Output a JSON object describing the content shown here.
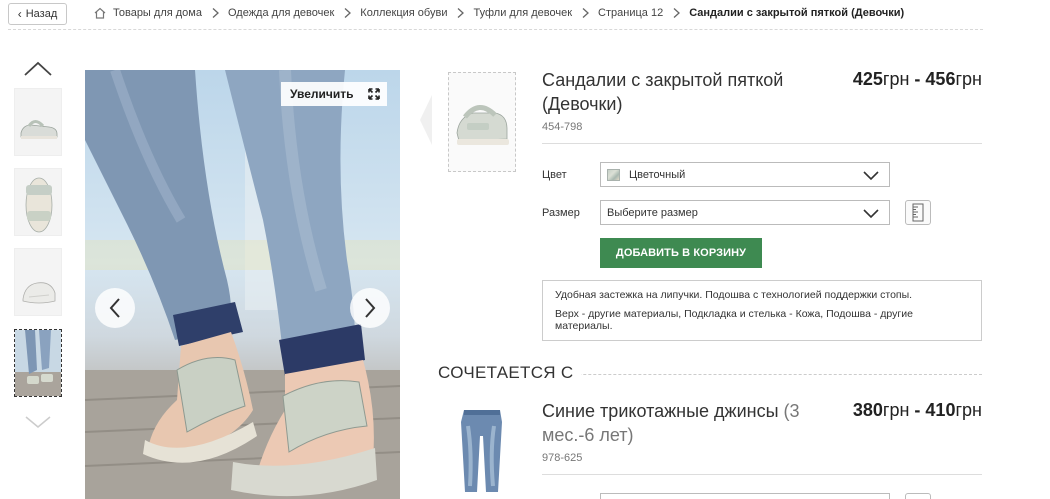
{
  "nav": {
    "back_label": "Назад",
    "breadcrumbs": [
      "Товары для дома",
      "Одежда для девочек",
      "Коллекция обуви",
      "Туфли для девочек",
      "Страница 12"
    ],
    "current": "Сандалии с закрытой пяткой (Девочки)"
  },
  "gallery": {
    "zoom_label": "Увеличить",
    "thumbnail_count": 4,
    "active_thumbnail": 4
  },
  "product": {
    "title": "Сандалии с закрытой пяткой (Девочки)",
    "price_from": "425",
    "price_to": "456",
    "currency": "грн",
    "price_separator": " - ",
    "code": "454-798",
    "color_label": "Цвет",
    "color_value": "Цветочный",
    "size_label": "Размер",
    "size_placeholder": "Выберите размер",
    "add_to_cart": "ДОБАВИТЬ В КОРЗИНУ",
    "description": [
      "Удобная застежка на липучки. Подошва с технологией поддержки стопы.",
      "Верх - другие материалы, Подкладка и стелька - Кожа, Подошва - другие материалы."
    ]
  },
  "goes_with": {
    "heading": "СОЧЕТАЕТСЯ С",
    "item": {
      "title_main": "Синие трикотажные джинсы",
      "title_age": "(3 мес.-6 лет)",
      "price_from": "380",
      "price_to": "410",
      "currency": "грн",
      "code": "978-625"
    }
  },
  "colors": {
    "accent_green": "#3e8a51",
    "text": "#333333",
    "muted": "#777777"
  }
}
